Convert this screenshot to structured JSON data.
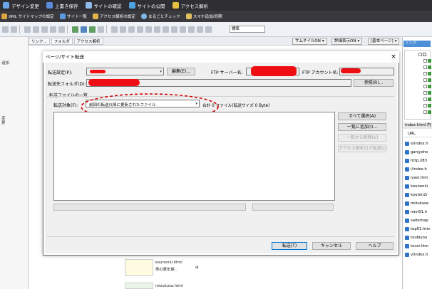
{
  "topbar": {
    "items": [
      {
        "label": "デザイン変更",
        "color": "#6aa6e8"
      },
      {
        "label": "上書き保存",
        "color": "#5b8bd9"
      },
      {
        "label": "サイトの確認",
        "color": "#8fb9e8"
      },
      {
        "label": "サイトの公開",
        "color": "#4ea2e0"
      },
      {
        "label": "アクセス解析",
        "color": "#e8c040"
      }
    ]
  },
  "menubar": {
    "items": [
      {
        "label": "XML サイトマップの設定",
        "color": "#d9a441"
      },
      {
        "label": "サイト一覧",
        "color": "#5b9be0"
      },
      {
        "label": "アクセス解析の設定",
        "color": "#e0b64a"
      },
      {
        "label": "まるごとチェック",
        "color": "#7cb8e8"
      },
      {
        "label": "スマホ追加/同期",
        "color": "#e0c060"
      }
    ]
  },
  "toolbar": {
    "mode": "標準"
  },
  "leftstrip": {
    "labels": [
      "追加",
      "変",
      "更"
    ]
  },
  "editor": {
    "tabs": [
      "リンク...",
      "フォルダ",
      "アクセス解析"
    ],
    "thumbnail_label": "サムネイルON",
    "detail_label": "詳細表示ON",
    "basic_page_label": "[基本ページ]",
    "chevron": "▾"
  },
  "rightpanel": {
    "title": "リンク",
    "index_header": "index.html 内",
    "url_header": "URL",
    "urls": [
      "e/index.h",
      "ganjyoho",
      "http://83",
      "i/index.h",
      "iyasi.htm",
      "kounenki",
      "kouten2r",
      "mizukusa",
      "navi01.h",
      "saitemap",
      "top01.htm",
      "toubiyou",
      "tousi.htm",
      "v/index.h"
    ]
  },
  "background_items": [
    {
      "name": "kounenki.html",
      "caption": "男の更年期..."
    },
    {
      "name": "mizukusa.html",
      "caption": ""
    }
  ],
  "dialog": {
    "title": "ページ/サイト転送",
    "close": "×",
    "transfer_setting_label": "転送設定(P):",
    "edit_button": "編集(E)...",
    "ftp_server_label": "FTP サーバー名:",
    "ftp_account_label": "FTP アカウント名:",
    "dest_folder_label": "転送先フォルダ(D):",
    "browse_button": "参照(R)...",
    "file_list_group": "転送ファイルの一覧",
    "target_label": "転送対象(F):",
    "target_value": "前回の転送以降に更新されたファイル",
    "summary": "合計 0 ファイル(転送サイズ 0 Byte)",
    "select_all_button": "すべて選択(A)",
    "add_to_list_button": "一覧に追加(I)...",
    "remove_from_list_button": "一覧から削除(V)",
    "access_log_button": "アクセス解析ログ転送(L)",
    "transfer_button": "転送(T)",
    "cancel_button": "キャンセル",
    "help_button": "ヘルプ",
    "redact_color": "#ee0e14",
    "annotation_color": "#d10000"
  }
}
